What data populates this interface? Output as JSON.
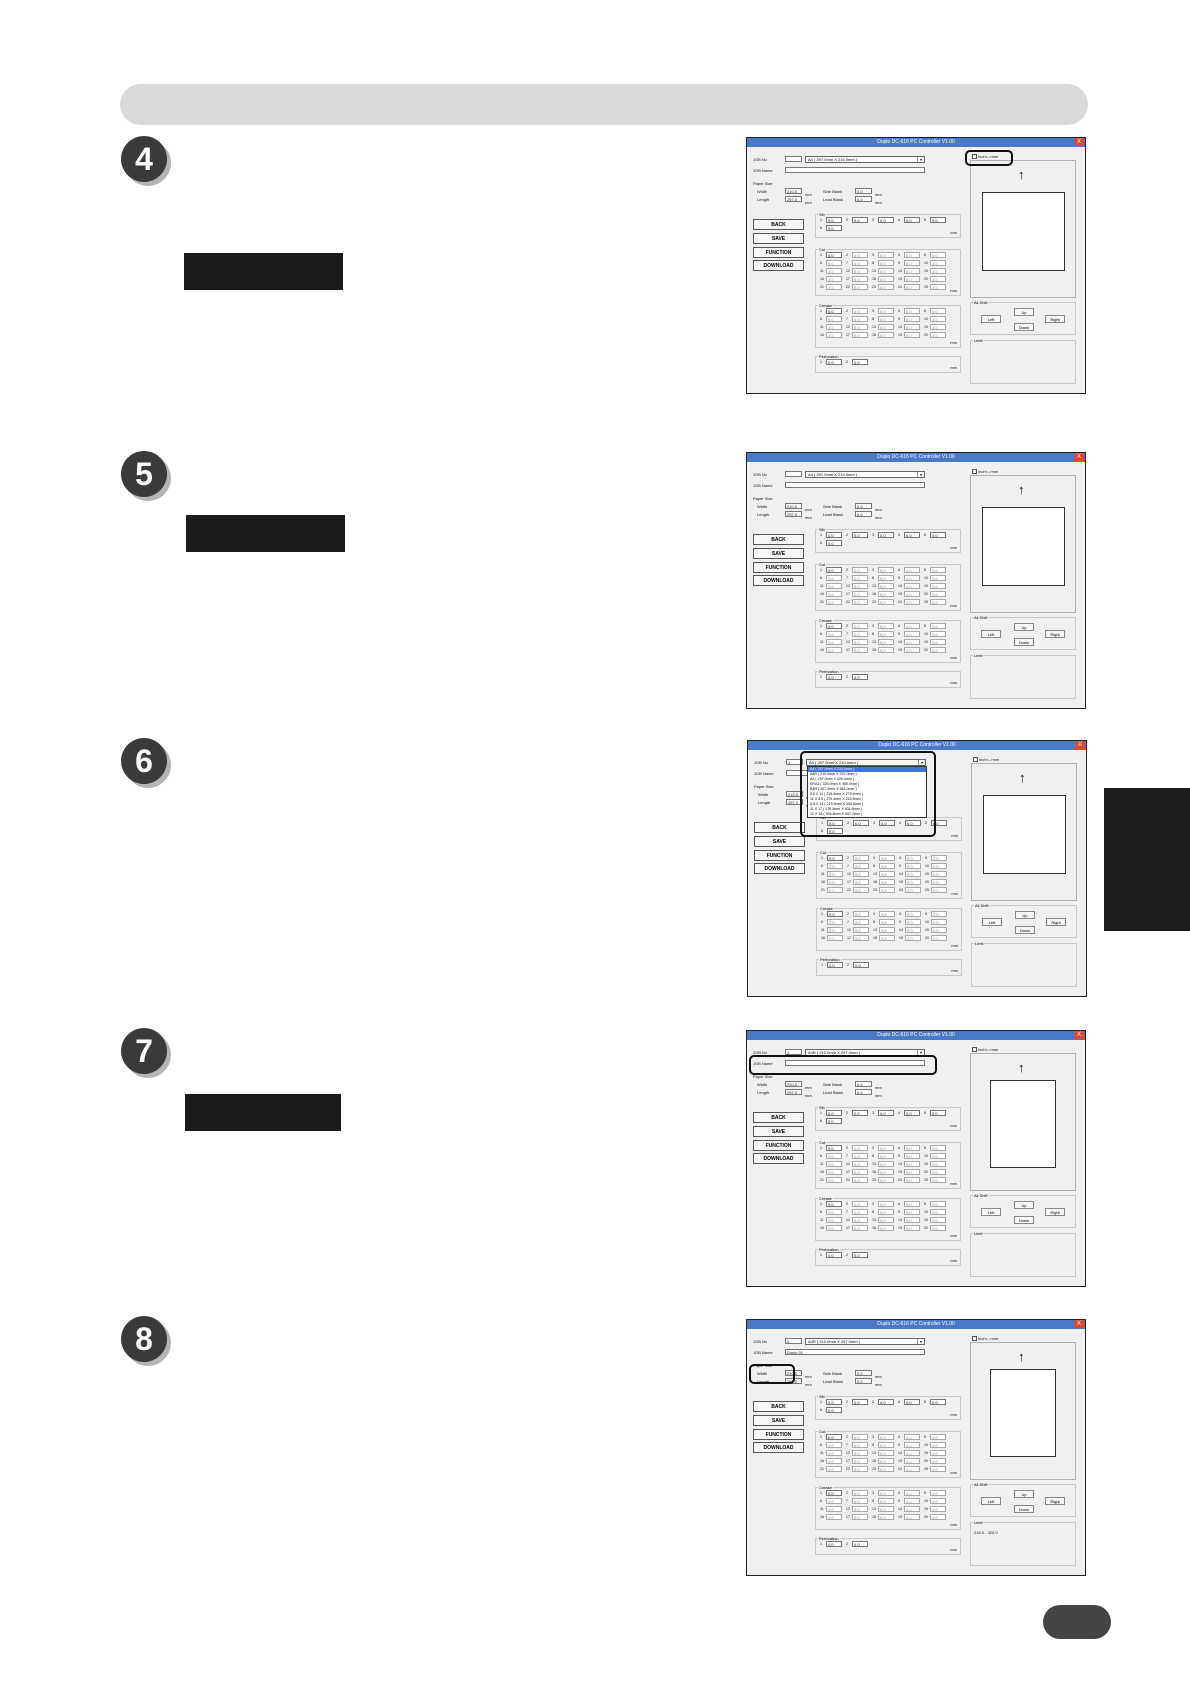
{
  "steps": [
    "4",
    "5",
    "6",
    "7",
    "8"
  ],
  "window": {
    "title": "Duplo DC-616 PC Controller V1.00",
    "close": "X",
    "inch_mm_label": "Inch<->mm",
    "job_no_label": "JOB No",
    "job_name_label": "JOB Name",
    "paper_size_label": "Paper Size",
    "width_label": "Width",
    "length_label": "Length",
    "side_blank_label": "Side Blank",
    "lead_blank_label": "Lead Blank",
    "mm": "mm",
    "buttons": [
      "BACK",
      "SAVE",
      "FUNCTION",
      "DOWNLOAD"
    ],
    "slit_label": "Slit",
    "cut_label": "Cut",
    "crease_label": "Crease",
    "perforation_label": "Perforation",
    "all_shift_label": "All Shift",
    "shift_buttons": {
      "up": "Up",
      "left": "Left",
      "right": "Right",
      "down": "Down"
    },
    "limit_label": "Limit",
    "default_value": "0.0",
    "dim_value": "0.0",
    "arrow": "↑"
  },
  "screens": [
    {
      "job_no": "",
      "paper": "A4 ( 297.0mm X 210.0mm )",
      "job_name": "",
      "width": "210.0",
      "length": "297.0",
      "limit": ""
    },
    {
      "job_no": "",
      "paper": "A4 ( 297.0mm X 210.0mm )",
      "job_name": "",
      "width": "210.0",
      "length": "297.0",
      "limit": ""
    },
    {
      "job_no": "1",
      "paper": "A4 ( 297.0mm X 210.0mm )",
      "job_name": "",
      "width": "210.0",
      "length": "297.0",
      "limit": ""
    },
    {
      "job_no": "1",
      "paper": "A4R ( 210.0mm X 297.0mm )",
      "job_name": "",
      "width": "210.0",
      "length": "297.0",
      "limit": ""
    },
    {
      "job_no": "1",
      "paper": "A4R ( 210.0mm X 297.0mm )",
      "job_name": "Duplo 01",
      "width": "210.0",
      "length": "297.0",
      "limit": "216.0 - 320.0"
    }
  ],
  "dropdown_options": [
    "A4 ( 297.0mm X 210.0mm )",
    "A4R ( 210.0mm X 297.0mm )",
    "A3 ( 297.0mm X 420.0mm )",
    "SRA3 ( 320.0mm X 450.0mm )",
    "B4R ( 257.0mm X 364.0mm )",
    "8.5 X 11 ( 215.9mm X 279.4mm )",
    "11 X 8.5 ( 279.4mm X 215.9mm )",
    "8.5 X 14 ( 215.9mm X 355.6mm )",
    "11 X 17 ( 279.4mm X 431.8mm )",
    "12 X 18 ( 304.8mm X 457.2mm )"
  ]
}
